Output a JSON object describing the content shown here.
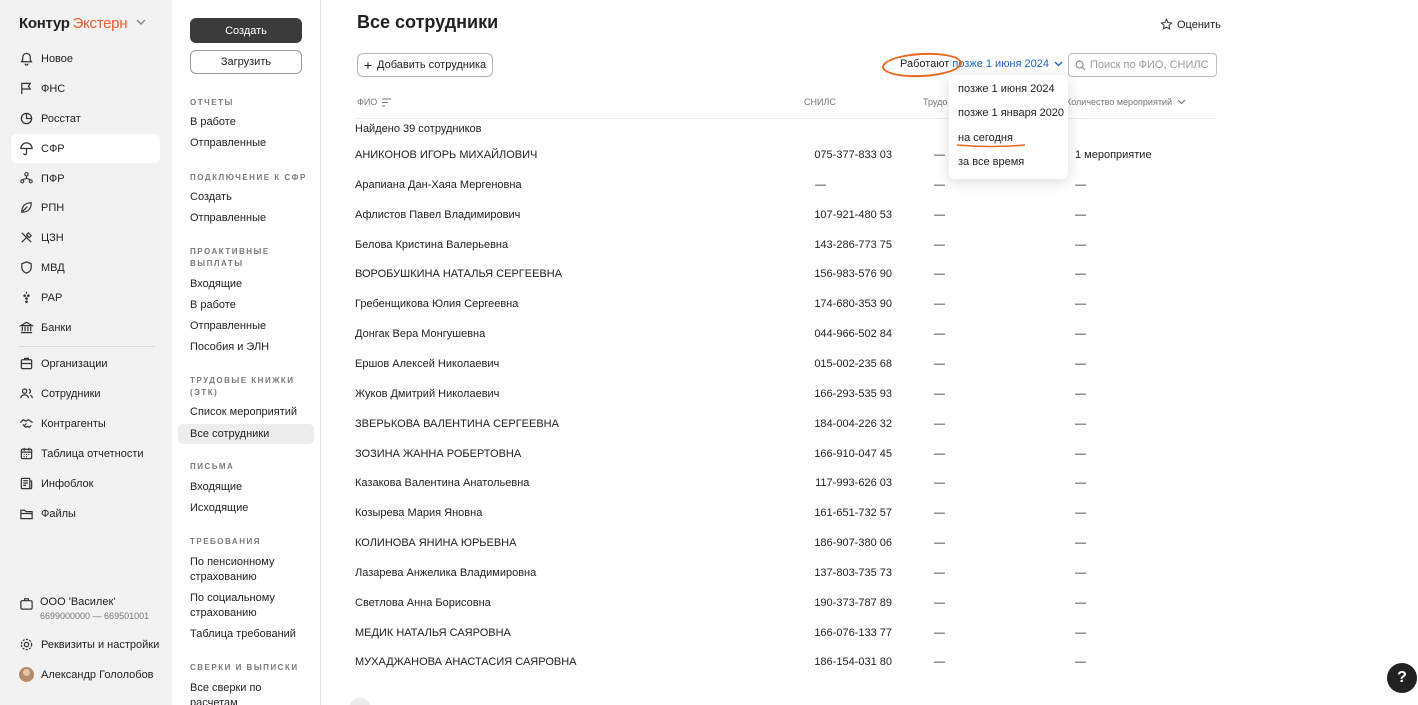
{
  "logo": {
    "part1": "Контур",
    "part2": "Экстерн"
  },
  "nav": {
    "items": [
      {
        "label": "Новое",
        "icon": "bell-icon"
      },
      {
        "label": "ФНС",
        "icon": "flag-icon"
      },
      {
        "label": "Росстат",
        "icon": "pie-chart-icon"
      },
      {
        "label": "СФР",
        "icon": "umbrella-icon"
      },
      {
        "label": "ПФР",
        "icon": "people-tree-icon"
      },
      {
        "label": "РПН",
        "icon": "leaf-icon"
      },
      {
        "label": "ЦЗН",
        "icon": "tools-icon"
      },
      {
        "label": "МВД",
        "icon": "shield-icon"
      },
      {
        "label": "РАР",
        "icon": "grapes-icon"
      },
      {
        "label": "Банки",
        "icon": "bank-icon"
      },
      {
        "label": "Организации",
        "icon": "building-icon"
      },
      {
        "label": "Сотрудники",
        "icon": "users-icon"
      },
      {
        "label": "Контрагенты",
        "icon": "handshake-icon"
      },
      {
        "label": "Таблица отчетности",
        "icon": "calendar-icon"
      },
      {
        "label": "Инфоблок",
        "icon": "news-icon"
      },
      {
        "label": "Файлы",
        "icon": "folder-icon"
      }
    ],
    "org_name": "ООО 'Василек'",
    "org_ids": "6699000000 — 669501001",
    "settings": "Реквизиты и настройки",
    "user": "Александр Гололобов"
  },
  "sub": {
    "create": "Создать",
    "upload": "Загрузить",
    "sections": [
      {
        "title": "ОТЧЕТЫ",
        "items": [
          "В работе",
          "Отправленные"
        ]
      },
      {
        "title": "ПОДКЛЮЧЕНИЕ К СФР",
        "items": [
          "Создать",
          "Отправленные"
        ]
      },
      {
        "title": "ПРОАКТИВНЫЕ ВЫПЛАТЫ",
        "items": [
          "Входящие",
          "В работе",
          "Отправленные",
          "Пособия и ЭЛН"
        ]
      },
      {
        "title": "ТРУДОВЫЕ КНИЖКИ (ЭТК)",
        "items": [
          "Список мероприятий",
          "Все сотрудники"
        ]
      },
      {
        "title": "ПИСЬМА",
        "items": [
          "Входящие",
          "Исходящие"
        ]
      },
      {
        "title": "ТРЕБОВАНИЯ",
        "items": [
          "По пенсионному страхованию",
          "По социальному страхованию",
          "Таблица требований"
        ]
      },
      {
        "title": "СВЕРКИ И ВЫПИСКИ",
        "items": [
          "Все сверки по расчетам"
        ]
      }
    ]
  },
  "main": {
    "title": "Все сотрудники",
    "rate": "Оценить",
    "add_employee": "Добавить сотрудника",
    "filter_label": "Работают",
    "filter_value": "позже 1 июня 2024",
    "search_placeholder": "Поиск по ФИО, СНИЛС",
    "headers": {
      "name": "ФИО",
      "snils": "СНИЛС",
      "tr": "Трудо",
      "count": "Количество мероприятий"
    },
    "found": "Найдено 39 сотрудников",
    "rows": [
      {
        "name": "АНИКОНОВ ИГОРЬ МИХАЙЛОВИЧ",
        "snils": "075-377-833 03",
        "tr": "—",
        "count": "1 мероприятие"
      },
      {
        "name": "Арапиана Дан-Хаяа Мергеновна",
        "snils": "—",
        "tr": "—",
        "count": "—"
      },
      {
        "name": "Афлистов Павел Владимирович",
        "snils": "107-921-480 53",
        "tr": "—",
        "count": "—"
      },
      {
        "name": "Белова Кристина Валерьевна",
        "snils": "143-286-773 75",
        "tr": "—",
        "count": "—"
      },
      {
        "name": "ВОРОБУШКИНА НАТАЛЬЯ СЕРГЕЕВНА",
        "snils": "156-983-576 90",
        "tr": "—",
        "count": "—"
      },
      {
        "name": "Гребенщикова Юлия Сергеевна",
        "snils": "174-680-353 90",
        "tr": "—",
        "count": "—"
      },
      {
        "name": "Донгак Вера Монгушевна",
        "snils": "044-966-502 84",
        "tr": "—",
        "count": "—"
      },
      {
        "name": "Ершов Алексей Николаевич",
        "snils": "015-002-235 68",
        "tr": "—",
        "count": "—"
      },
      {
        "name": "Жуков Дмитрий Николаевич",
        "snils": "166-293-535 93",
        "tr": "—",
        "count": "—"
      },
      {
        "name": "ЗВЕРЬКОВА ВАЛЕНТИНА СЕРГЕЕВНА",
        "snils": "184-004-226 32",
        "tr": "—",
        "count": "—"
      },
      {
        "name": "ЗОЗИНА ЖАННА РОБЕРТОВНА",
        "snils": "166-910-047 45",
        "tr": "—",
        "count": "—"
      },
      {
        "name": "Казакова Валентина Анатольевна",
        "snils": "117-993-626 03",
        "tr": "—",
        "count": "—"
      },
      {
        "name": "Козырева Мария Яновна",
        "snils": "161-651-732 57",
        "tr": "—",
        "count": "—"
      },
      {
        "name": "КОЛИНОВА ЯНИНА ЮРЬЕВНА",
        "snils": "186-907-380 06",
        "tr": "—",
        "count": "—"
      },
      {
        "name": "Лазарева Анжелика Владимировна",
        "snils": "137-803-735 73",
        "tr": "—",
        "count": "—"
      },
      {
        "name": "Светлова Анна Борисовна",
        "snils": "190-373-787 89",
        "tr": "—",
        "count": "—"
      },
      {
        "name": "МЕДИК НАТАЛЬЯ САЯРОВНА",
        "snils": "166-076-133 77",
        "tr": "—",
        "count": "—"
      },
      {
        "name": "МУХАДЖАНОВА АНАСТАСИЯ САЯРОВНА",
        "snils": "186-154-031 80",
        "tr": "—",
        "count": "—"
      }
    ]
  },
  "dropdown": {
    "options": [
      "позже 1 июня 2024",
      "позже 1 января 2020",
      "на сегодня",
      "за все время"
    ]
  },
  "help": "?",
  "colors": {
    "accent": "#1b65c6",
    "brand": "#ee5a2b",
    "annotation": "#e8671e"
  }
}
